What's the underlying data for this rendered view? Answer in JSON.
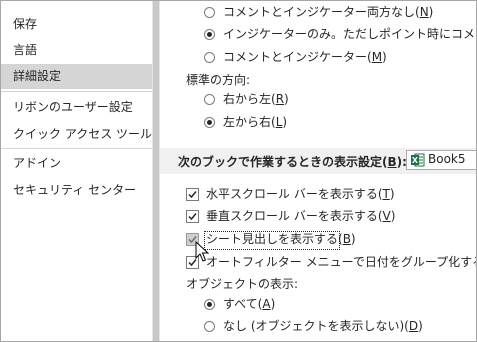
{
  "sidebar": {
    "items": [
      {
        "label": "保存"
      },
      {
        "label": "言語"
      },
      {
        "label": "詳細設定"
      },
      {
        "label": "リボンのユーザー設定"
      },
      {
        "label": "クイック アクセス ツール バー"
      },
      {
        "label": "アドイン"
      },
      {
        "label": "セキュリティ センター"
      }
    ],
    "selected": "詳細設定"
  },
  "comments": {
    "opt1_label": "コメントとインジケーター両方なし(",
    "opt1_key": "N",
    "opt2_label": "インジケーターのみ。ただしポイント時にコメントを表示(",
    "opt2_key": "I",
    "opt3_label": "コメントとインジケーター(",
    "opt3_key": "M",
    "selected": "opt2"
  },
  "direction": {
    "heading": "標準の方向:",
    "rtl_label": "右から左(",
    "rtl_key": "R",
    "ltr_label": "左から右(",
    "ltr_key": "L",
    "selected": "ltr"
  },
  "workbook_section": {
    "title": "次のブックで作業するときの表示設定(",
    "title_key": "B",
    "title_tail": "):",
    "book_icon": "excel-icon",
    "book_value": "Book5"
  },
  "workbook_options": {
    "hscroll_label": "水平スクロール バーを表示する(",
    "hscroll_key": "T",
    "vscroll_label": "垂直スクロール バーを表示する(",
    "vscroll_key": "V",
    "sheettabs_label": "シート見出しを表示する(",
    "sheettabs_key": "B",
    "autofilter_label": "オートフィルター メニューで日付をグループ化する(",
    "autofilter_key": "G"
  },
  "objects": {
    "heading": "オブジェクトの表示:",
    "all_label": "すべて(",
    "all_key": "A",
    "none_label": "なし (オブジェクトを表示しない)(",
    "none_key": "D",
    "selected": "all"
  },
  "colors": {
    "selected_nav_bg": "#d5d5d5",
    "section_bg": "#f0f0f0",
    "excel_green": "#1e7145"
  }
}
